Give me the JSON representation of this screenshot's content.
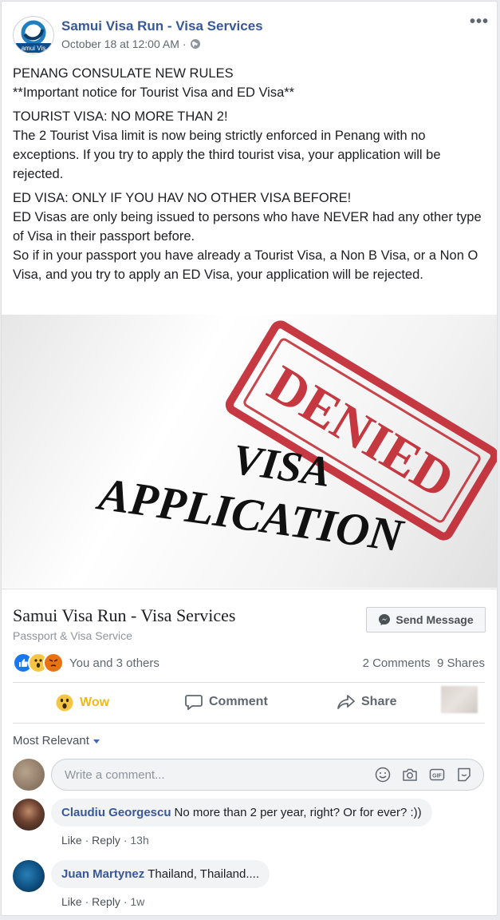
{
  "post": {
    "page_name": "Samui Visa Run - Visa Services",
    "date": "October 18 at 12:00 AM",
    "separator": "·",
    "avatar_text": "amui Vis",
    "paragraphs": [
      {
        "lines": [
          "PENANG CONSULATE NEW RULES",
          "**Important notice for Tourist Visa and ED Visa**"
        ]
      },
      {
        "lines": [
          "TOURIST VISA: NO MORE THAN 2!",
          "The 2 Tourist Visa limit is now being strictly enforced in Penang with no exceptions. If you try to apply the third tourist visa, your application will be rejected."
        ]
      },
      {
        "lines": [
          "ED VISA: ONLY IF YOU HAV NO OTHER VISA BEFORE!",
          "ED Visas are only being issued to persons who have NEVER had any other type of Visa in their passport before.",
          "So if in your passport you have already a Tourist Visa, a Non B Visa, or a Non O Visa, and you try to apply an ED Visa, your application will be rejected."
        ]
      }
    ],
    "image": {
      "stamp": "DENIED",
      "line1": "VISA",
      "line2": "APPLICATION"
    }
  },
  "link": {
    "title": "Samui Visa Run - Visa Services",
    "subtitle": "Passport & Visa Service",
    "send_label": "Send Message"
  },
  "reactions": {
    "summary": "You and 3 others",
    "comments": "2 Comments",
    "shares": "9 Shares"
  },
  "actions": {
    "wow": "Wow",
    "comment": "Comment",
    "share": "Share"
  },
  "comments_section": {
    "sort_label": "Most Relevant",
    "input_placeholder": "Write a comment...",
    "comments": [
      {
        "author": "Claudiu Georgescu",
        "text": "No more than 2 per year, right? Or for ever? :))",
        "like": "Like",
        "reply": "Reply",
        "time": "13h"
      },
      {
        "author": "Juan Martynez",
        "text": "Thailand, Thailand....",
        "like": "Like",
        "reply": "Reply",
        "time": "1w"
      }
    ]
  },
  "colors": {
    "link_blue": "#385898",
    "stamp_red": "#c0242d",
    "wow_yellow": "#f0ba15"
  }
}
